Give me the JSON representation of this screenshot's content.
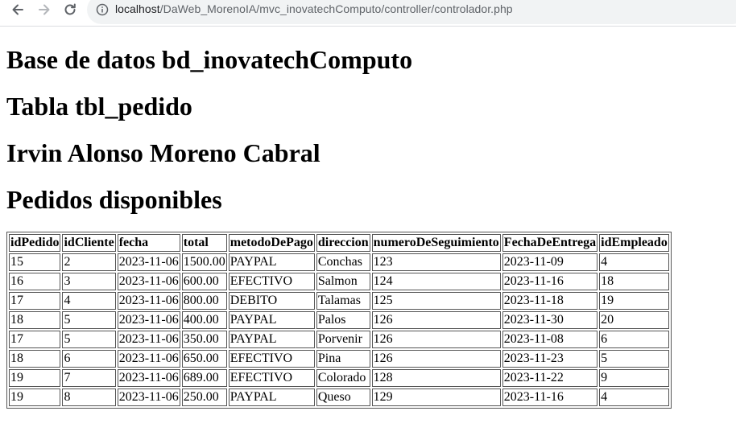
{
  "browser": {
    "url_host": "localhost",
    "url_path": "/DaWeb_MorenoIA/mvc_inovatechComputo/controller/controlador.php"
  },
  "headings": {
    "database": "Base de datos bd_inovatechComputo",
    "table": "Tabla tbl_pedido",
    "author": "Irvin Alonso Moreno Cabral",
    "section": "Pedidos disponibles"
  },
  "orders_table": {
    "columns": [
      "idPedido",
      "idCliente",
      "fecha",
      "total",
      "metodoDePago",
      "direccion",
      "numeroDeSeguimiento",
      "FechaDeEntrega",
      "idEmpleado"
    ],
    "rows": [
      [
        "15",
        "2",
        "2023-11-06",
        "1500.00",
        "PAYPAL",
        "Conchas",
        "123",
        "2023-11-09",
        "4"
      ],
      [
        "16",
        "3",
        "2023-11-06",
        "600.00",
        "EFECTIVO",
        "Salmon",
        "124",
        "2023-11-16",
        "18"
      ],
      [
        "17",
        "4",
        "2023-11-06",
        "800.00",
        "DEBITO",
        "Talamas",
        "125",
        "2023-11-18",
        "19"
      ],
      [
        "18",
        "5",
        "2023-11-06",
        "400.00",
        "PAYPAL",
        "Palos",
        "126",
        "2023-11-30",
        "20"
      ],
      [
        "17",
        "5",
        "2023-11-06",
        "350.00",
        "PAYPAL",
        "Porvenir",
        "126",
        "2023-11-08",
        "6"
      ],
      [
        "18",
        "6",
        "2023-11-06",
        "650.00",
        "EFECTIVO",
        "Pina",
        "126",
        "2023-11-23",
        "5"
      ],
      [
        "19",
        "7",
        "2023-11-06",
        "689.00",
        "EFECTIVO",
        "Colorado",
        "128",
        "2023-11-22",
        "9"
      ],
      [
        "19",
        "8",
        "2023-11-06",
        "250.00",
        "PAYPAL",
        "Queso",
        "129",
        "2023-11-16",
        "4"
      ]
    ]
  }
}
